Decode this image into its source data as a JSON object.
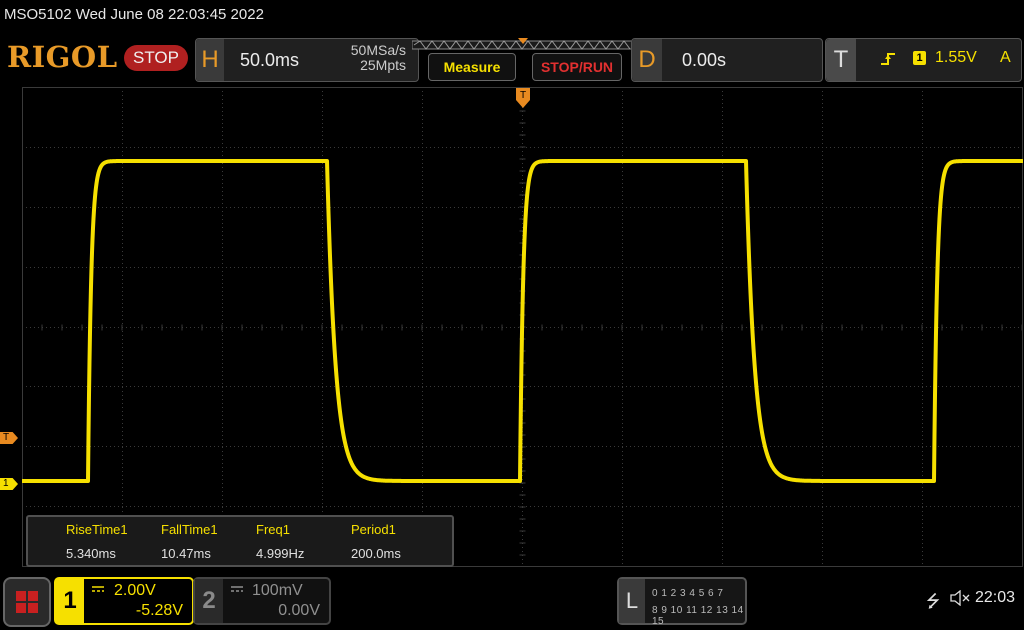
{
  "header": {
    "title": "MSO5102  Wed June 08 22:03:45 2022",
    "logo": "RIGOL",
    "status": "STOP"
  },
  "horizontal": {
    "letter": "H",
    "scale": "50.0ms",
    "sample_rate": "50MSa/s",
    "memory_depth": "25Mpts"
  },
  "buttons": {
    "measure": "Measure",
    "stop_run": "STOP/RUN"
  },
  "delay": {
    "letter": "D",
    "value": "0.00s"
  },
  "trigger": {
    "letter": "T",
    "source": "1",
    "level": "1.55V",
    "mode": "A"
  },
  "markers": {
    "trigger_level": "T",
    "ch1_ground": "1"
  },
  "measurements": [
    {
      "name": "RiseTime1",
      "value": "5.340ms"
    },
    {
      "name": "FallTime1",
      "value": "10.47ms"
    },
    {
      "name": "Freq1",
      "value": "4.999Hz"
    },
    {
      "name": "Period1",
      "value": "200.0ms"
    }
  ],
  "channels": {
    "ch1": {
      "number": "1",
      "scale": "2.00V",
      "offset": "-5.28V",
      "color": "#f6e000"
    },
    "ch2": {
      "number": "2",
      "scale": "100mV",
      "offset": "0.00V",
      "color": "#909090"
    }
  },
  "logic": {
    "letter": "L",
    "row1": "0 1 2 3   4 5 6 7",
    "row2": "8 9 10 11 12 13 14 15"
  },
  "status_bar": {
    "time": "22:03"
  },
  "waveform": {
    "type": "square",
    "color": "#f6e000",
    "grid_color": "#3a3a3a"
  }
}
